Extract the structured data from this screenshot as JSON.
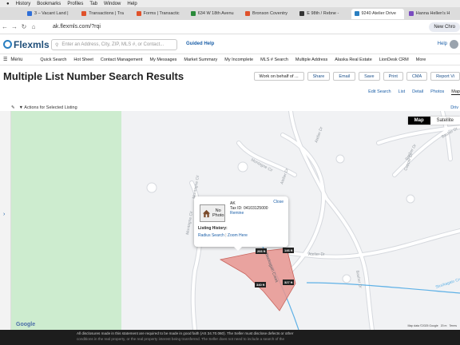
{
  "system_menu": [
    "History",
    "Bookmarks",
    "Profiles",
    "Tab",
    "Window",
    "Help"
  ],
  "tabs": [
    {
      "label": "3 – Vacant Land |",
      "color": "#2f6fd8"
    },
    {
      "label": "Transactions | Tra",
      "color": "#e0522b"
    },
    {
      "label": "Forms | Transactic",
      "color": "#e0522b"
    },
    {
      "label": "634 W 18th Avenu",
      "color": "#2a8a3a"
    },
    {
      "label": "Bronson Coventry",
      "color": "#e0522b"
    },
    {
      "label": "E 98th / Rebne -",
      "color": "#333333"
    },
    {
      "label": "9240 Atelier Drive",
      "color": "#2a7fc1",
      "active": true
    },
    {
      "label": "Hanna Hellen's H",
      "color": "#7a4cc0"
    }
  ],
  "browser": {
    "url": "ak.flexmls.com/?rqi",
    "new_chrome": "New Chro"
  },
  "app": {
    "logo_text": "Flexmls",
    "search_placeholder": "Enter an Address, City, ZIP, MLS #, or Contact...",
    "guided_help": "Guided Help",
    "help": "Help"
  },
  "nav": {
    "menu_label": "Menu",
    "items": [
      "Quick Search",
      "Hot Sheet",
      "Contact Management",
      "My Messages",
      "Market Summary",
      "My Incomplete",
      "MLS # Search",
      "Multiple Address",
      "Alaska Real Estate",
      "LionDesk CRM",
      "More"
    ]
  },
  "page": {
    "title": "Multiple List Number Search Results",
    "buttons": [
      "Work on behalf of ...",
      "Share",
      "Email",
      "Save",
      "Print",
      "CMA",
      "Report Vi"
    ],
    "view_tabs": [
      "Edit Search",
      "List",
      "Detail",
      "Photos",
      "Map"
    ],
    "active_view": "Map",
    "actions_label": "Actions for Selected Listing",
    "drive_label": "Driv"
  },
  "map": {
    "type_buttons": [
      "Map",
      "Satellite"
    ],
    "active_type": "Map",
    "streets": [
      "Montagne Cir",
      "Montagne Cir",
      "Montagne Cir",
      "Atelier Dr",
      "Atelier Dr",
      "Atelier Dr",
      "Basher Dr",
      "Basher Dr",
      "Basher Dr",
      "Copper Dr",
      "Stuckagain Creek",
      "Stuckagain Creek"
    ],
    "lot_labels": [
      "266 ft",
      "146 ft",
      "327 ft",
      "340 ft"
    ],
    "popup": {
      "close": "Close",
      "photo_text": [
        "No",
        "Photo"
      ],
      "state": "AK",
      "tax_id": "Tax ID: 04103125000",
      "remine": "Remine",
      "history_heading": "Listing History:",
      "radius_search": "Radius Search",
      "separator": "|",
      "zoom_here": "Zoom Here"
    },
    "google_logo": "Google",
    "attribution": [
      "Map data ©2025 Google",
      "20 m",
      "Terms"
    ],
    "colors": {
      "parcel": "#e8958f",
      "greenbelt": "#cdeccf",
      "road": "#ffffff",
      "creek": "#5fb1e6"
    }
  },
  "disclosure": {
    "lines": [
      "All disclosures made in this statement are required to be made in good faith (AS 34.70.060). The Seller must disclose defects or other",
      "conditions in the real property, or the real property interest being transferred. The Seller does not need to include a search of the"
    ]
  }
}
